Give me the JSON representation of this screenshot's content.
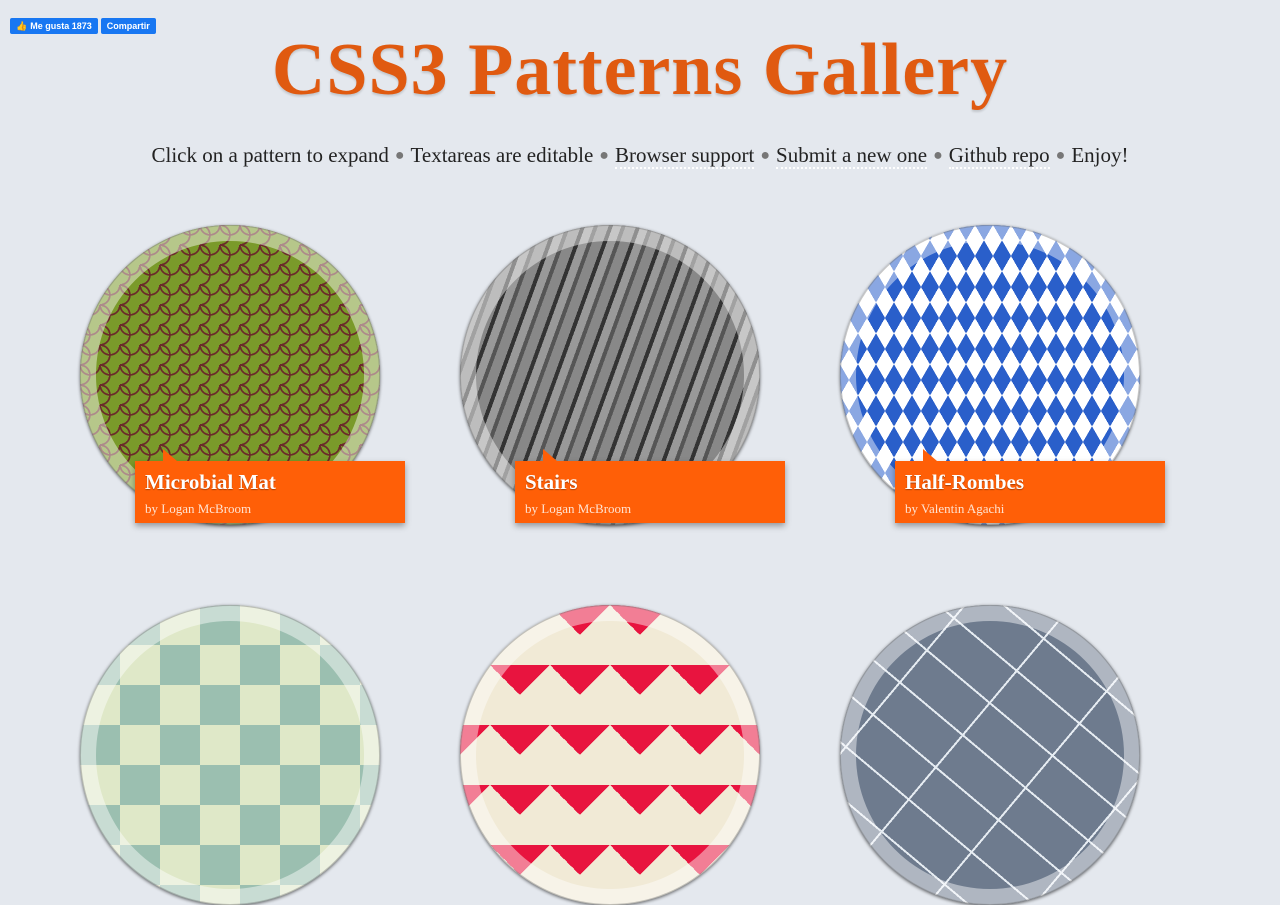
{
  "facebook": {
    "like_label": "Me gusta 1873",
    "share_label": "Compartir",
    "like_icon": "thumbs-up-icon"
  },
  "page_title": "CSS3 Patterns Gallery",
  "subnav": {
    "items": [
      "Click on a pattern to expand",
      "Textareas are editable",
      "Browser support",
      "Submit a new one",
      "Github repo",
      "Enjoy!"
    ],
    "separator": "●"
  },
  "colors": {
    "title": "#e05a10",
    "caption_bg": "#ff5f07",
    "page_bg": "#e4e8ee"
  },
  "patterns": [
    {
      "title": "Microbial Mat",
      "author": "by Logan McBroom"
    },
    {
      "title": "Stairs",
      "author": "by Logan McBroom"
    },
    {
      "title": "Half-Rombes",
      "author": "by Valentin Agachi"
    }
  ]
}
